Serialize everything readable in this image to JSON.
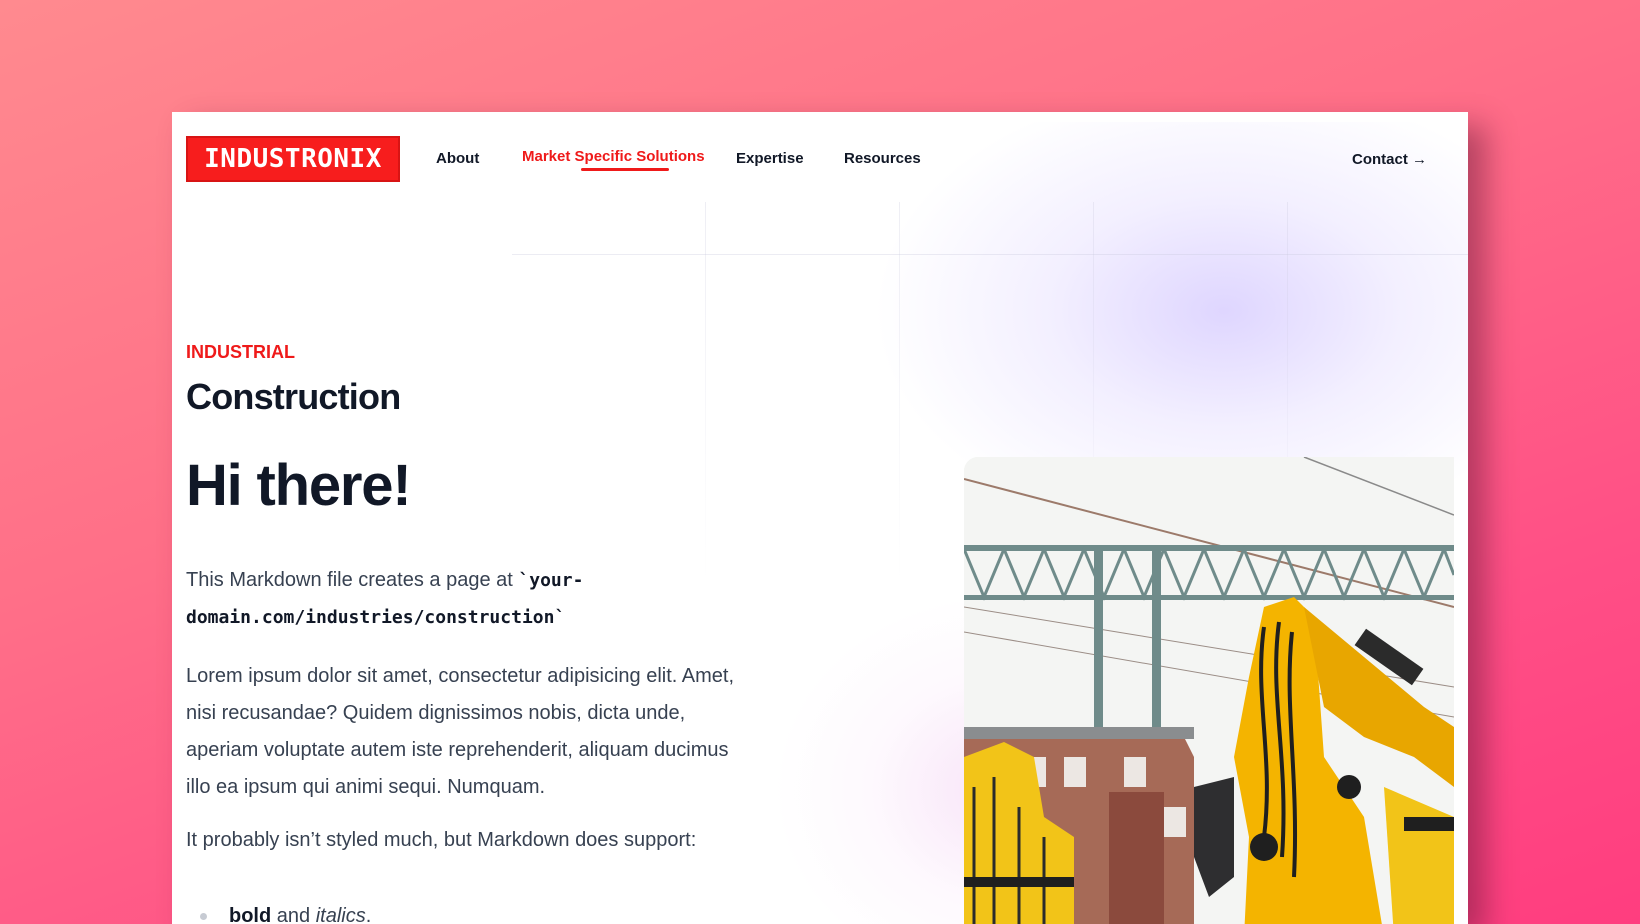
{
  "brand": {
    "logo_text": "INDUSTRONIX"
  },
  "nav": {
    "items": [
      {
        "label": "About"
      },
      {
        "label": "Market Specific Solutions"
      },
      {
        "label": "Expertise"
      },
      {
        "label": "Resources"
      }
    ],
    "contact_label": "Contact →"
  },
  "page": {
    "kicker": "INDUSTRIAL",
    "title": "Construction",
    "heading": "Hi there!",
    "p1_text": "This Markdown file creates a page at ",
    "p1_code": "`your-domain.com/industries/construction`",
    "p2": "Lorem ipsum dolor sit amet, consectetur adipisicing elit. Amet, nisi recusandae? Quidem dignissimos nobis, dicta unde, aperiam voluptate autem iste reprehenderit, aliquam ducimus illo ea ipsum qui animi sequi. Numquam.",
    "p3": "It probably isn’t styled much, but Markdown does support:",
    "bullet_bold": "bold",
    "bullet_and": " and ",
    "bullet_italic": "italics",
    "bullet_end": "."
  },
  "colors": {
    "brand": "#f71d1d",
    "text": "#111827",
    "accent": "#ef1a1a"
  }
}
